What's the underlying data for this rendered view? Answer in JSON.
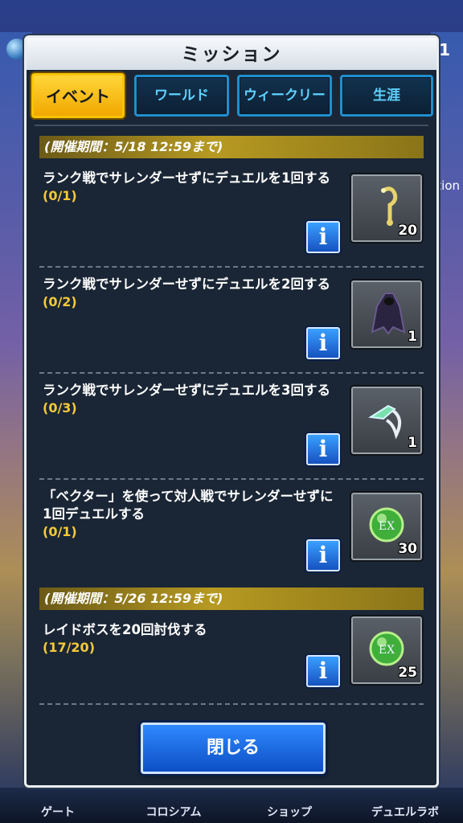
{
  "background": {
    "top_right_number": "1",
    "side_text": "tion"
  },
  "dialog": {
    "title": "ミッション",
    "close_label": "閉じる"
  },
  "tabs": [
    {
      "label": "イベント",
      "active": true
    },
    {
      "label": "ワールド",
      "active": false
    },
    {
      "label": "ウィークリー",
      "active": false
    },
    {
      "label": "生涯",
      "active": false
    }
  ],
  "periods": [
    {
      "label": "(開催期間：5/18 12:59まで)"
    },
    {
      "label": "(開催期間：5/26 12:59まで)"
    }
  ],
  "missions": [
    {
      "text": "ランク戦でサレンダーせずにデュエルを1回する",
      "progress": "(0/1)",
      "reward_icon": "key-icon",
      "reward_count": "20"
    },
    {
      "text": "ランク戦でサレンダーせずにデュエルを2回する",
      "progress": "(0/2)",
      "reward_icon": "dark-cloak-icon",
      "reward_count": "1"
    },
    {
      "text": "ランク戦でサレンダーせずにデュエルを3回する",
      "progress": "(0/3)",
      "reward_icon": "blade-icon",
      "reward_count": "1"
    },
    {
      "text": "「ベクター」を使って対人戦でサレンダーせずに1回デュエルする",
      "progress": "(0/1)",
      "reward_icon": "green-orb-icon",
      "reward_count": "30"
    },
    {
      "text": "レイドボスを20回討伐する",
      "progress": "(17/20)",
      "reward_icon": "green-orb-icon",
      "reward_count": "25"
    }
  ],
  "info_label": "i",
  "bottom_nav": [
    {
      "label": "ゲート"
    },
    {
      "label": "コロシアム"
    },
    {
      "label": "ショップ"
    },
    {
      "label": "デュエルラボ"
    }
  ],
  "colors": {
    "tab_active": "#f7c400",
    "tab_border": "#1e8fd0",
    "progress": "#f5c93a",
    "button_blue": "#1552c0"
  }
}
